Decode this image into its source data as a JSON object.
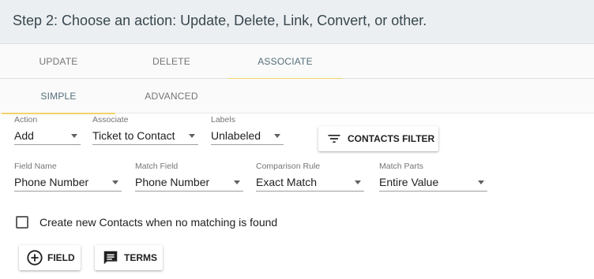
{
  "header": {
    "title": "Step 2: Choose an action: Update, Delete, Link, Convert, or other."
  },
  "primary_tabs": [
    {
      "label": "UPDATE",
      "active": false
    },
    {
      "label": "DELETE",
      "active": false
    },
    {
      "label": "ASSOCIATE",
      "active": true
    }
  ],
  "secondary_tabs": [
    {
      "label": "SIMPLE",
      "active": true
    },
    {
      "label": "ADVANCED",
      "active": false
    }
  ],
  "row1": {
    "action": {
      "label": "Action",
      "value": "Add"
    },
    "associate": {
      "label": "Associate",
      "value": "Ticket to Contact"
    },
    "labels": {
      "label": "Labels",
      "value": "Unlabeled"
    },
    "filter_button": {
      "label": "CONTACTS FILTER",
      "icon": "filter-list-icon"
    }
  },
  "row2": {
    "field_name": {
      "label": "Field Name",
      "value": "Phone Number"
    },
    "match_field": {
      "label": "Match Field",
      "value": "Phone Number"
    },
    "comparison_rule": {
      "label": "Comparison Rule",
      "value": "Exact Match"
    },
    "match_parts": {
      "label": "Match Parts",
      "value": "Entire Value"
    }
  },
  "create_contacts": {
    "label": "Create new Contacts when no matching is found",
    "checked": false
  },
  "actions": {
    "field_button": {
      "label": "FIELD",
      "icon": "add-circle-icon"
    },
    "terms_button": {
      "label": "TERMS",
      "icon": "comment-icon"
    }
  },
  "colors": {
    "accent": "#f2d36a",
    "header_bg": "#eceff1",
    "active_tab": "#546e7a"
  }
}
